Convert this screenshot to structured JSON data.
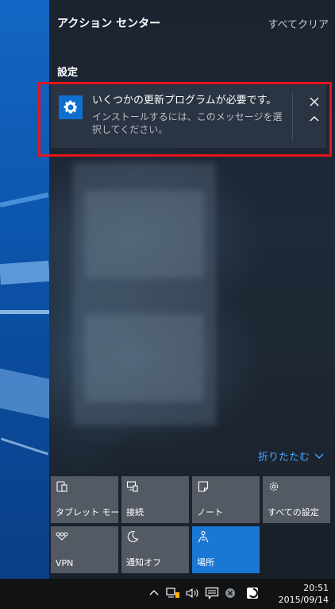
{
  "action_center": {
    "title": "アクション センター",
    "clear_all": "すべてクリア",
    "section_label": "設定"
  },
  "notification": {
    "icon": "gear-icon",
    "title": "いくつかの更新プログラムが必要です。",
    "body": "インストールするには、このメッセージを選択してください。"
  },
  "collapse_label": "折りたたむ",
  "quick_actions": [
    {
      "label": "タブレット モード",
      "icon": "tablet-mode-icon",
      "active": false
    },
    {
      "label": "接続",
      "icon": "connect-icon",
      "active": false
    },
    {
      "label": "ノート",
      "icon": "note-icon",
      "active": false
    },
    {
      "label": "すべての設定",
      "icon": "gear-icon",
      "active": false
    },
    {
      "label": "VPN",
      "icon": "vpn-icon",
      "active": false
    },
    {
      "label": "通知オフ",
      "icon": "moon-icon",
      "active": false
    },
    {
      "label": "場所",
      "icon": "location-icon",
      "active": true
    }
  ],
  "taskbar": {
    "time": "20:51",
    "date": "2015/09/14"
  },
  "colors": {
    "accent": "#1a78d4",
    "highlight_box": "#e8141c",
    "link": "#4aa3ff"
  }
}
